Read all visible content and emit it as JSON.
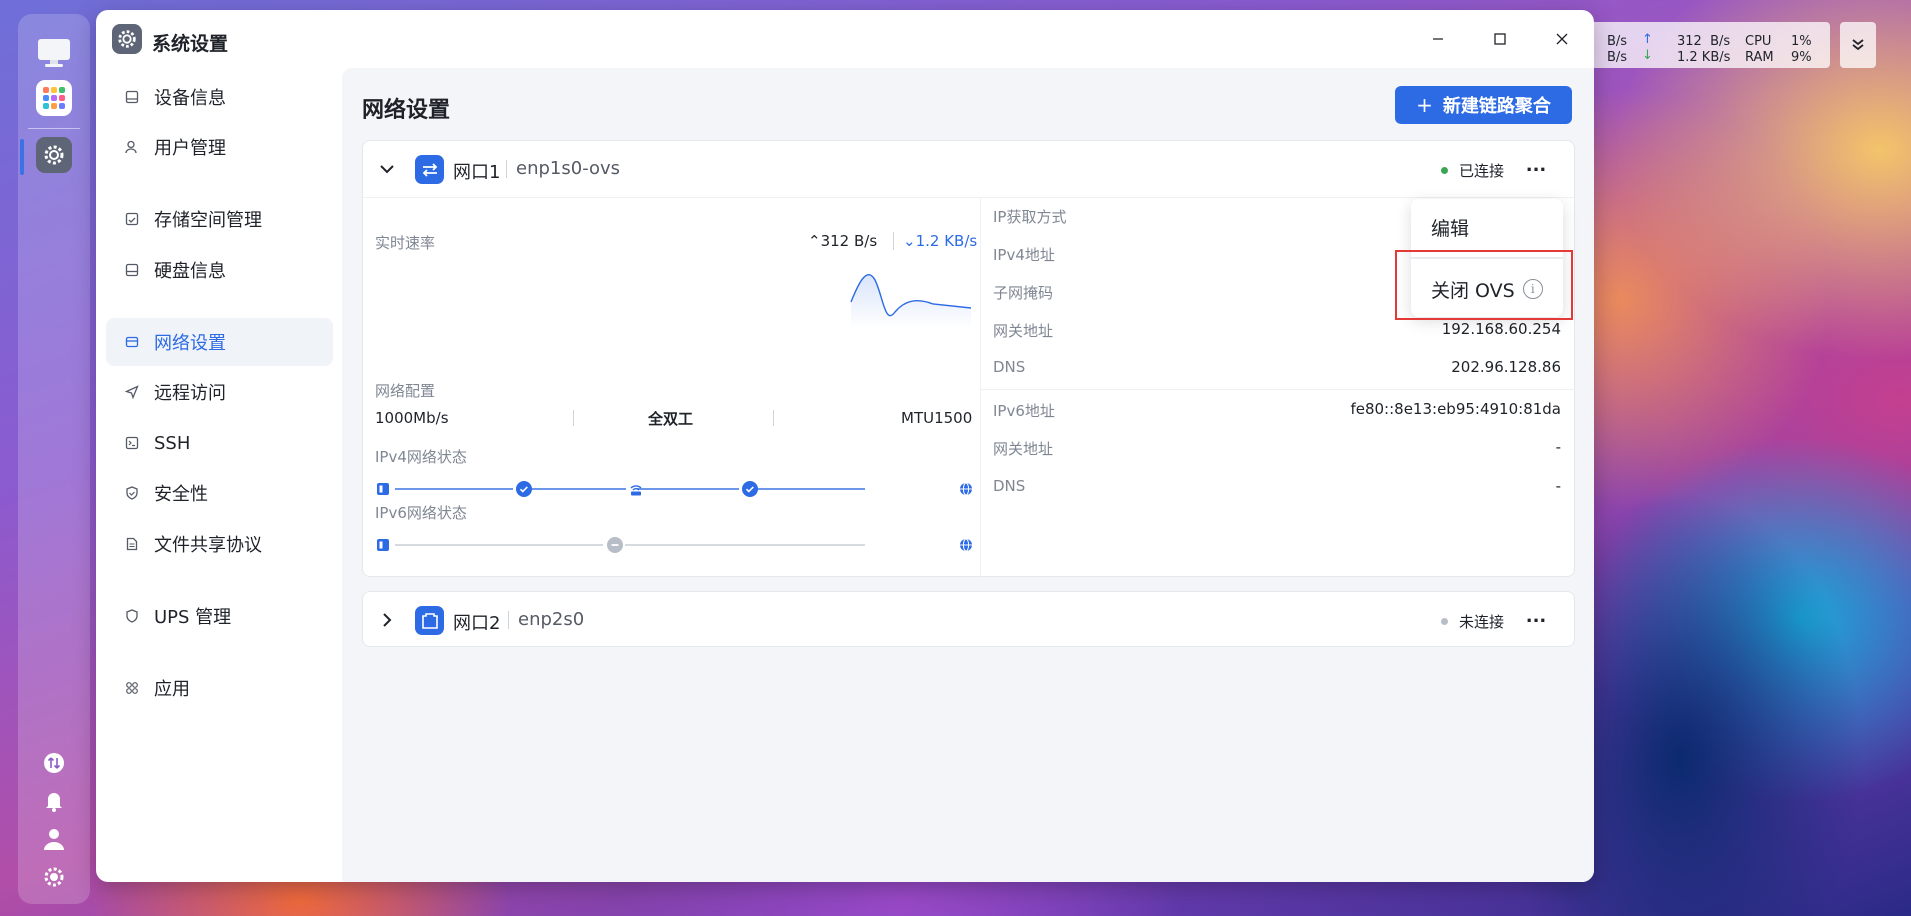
{
  "window": {
    "title": "系统设置",
    "controls": {
      "minimize": "minimize-icon",
      "maximize": "maximize-icon",
      "close": "close-icon"
    }
  },
  "sidebar": {
    "items": [
      {
        "label": "设备信息",
        "icon": "device-icon"
      },
      {
        "label": "用户管理",
        "icon": "user-icon"
      },
      {
        "label": "存储空间管理",
        "icon": "storage-icon"
      },
      {
        "label": "硬盘信息",
        "icon": "disk-icon"
      },
      {
        "label": "网络设置",
        "icon": "network-icon",
        "active": true
      },
      {
        "label": "远程访问",
        "icon": "remote-icon"
      },
      {
        "label": "SSH",
        "icon": "terminal-icon"
      },
      {
        "label": "安全性",
        "icon": "shield-icon"
      },
      {
        "label": "文件共享协议",
        "icon": "file-share-icon"
      },
      {
        "label": "UPS 管理",
        "icon": "ups-icon"
      },
      {
        "label": "应用",
        "icon": "apps-icon"
      }
    ]
  },
  "main": {
    "title": "网络设置",
    "new_button": "新建链路聚合"
  },
  "port1": {
    "name": "网口1",
    "iface": "enp1s0-ovs",
    "status": "已连接",
    "status_color": "#3aa655",
    "more": "...",
    "speed_label": "实时速率",
    "upload": "312 B/s",
    "download": "1.2 KB/s",
    "config_label": "网络配置",
    "link_speed": "1000Mb/s",
    "duplex": "全双工",
    "mtu": "MTU1500",
    "ipv4_status_label": "IPv4网络状态",
    "ipv6_status_label": "IPv6网络状态",
    "ipv4_fields": [
      {
        "key": "IP获取方式",
        "value": ""
      },
      {
        "key": "IPv4地址",
        "value": ""
      },
      {
        "key": "子网掩码",
        "value": ""
      },
      {
        "key": "网关地址",
        "value": "192.168.60.254"
      },
      {
        "key": "DNS",
        "value": "202.96.128.86"
      }
    ],
    "ipv6_fields": [
      {
        "key": "IPv6地址",
        "value": "fe80::8e13:eb95:4910:81da"
      },
      {
        "key": "网关地址",
        "value": "-"
      },
      {
        "key": "DNS",
        "value": "-"
      }
    ]
  },
  "port2": {
    "name": "网口2",
    "iface": "enp2s0",
    "status": "未连接",
    "status_color": "#b8bec8",
    "more": "..."
  },
  "context_menu": {
    "edit": "编辑",
    "close_ovs": "关闭 OVS",
    "info_glyph": "i"
  },
  "sysmon": {
    "net_up_partial": "B/s",
    "net_down_partial": "B/s",
    "up_arrow": "↑",
    "down_arrow": "↓",
    "up_value": "312  B/s",
    "down_value": "1.2 KB/s",
    "cpu_label": "CPU",
    "cpu_value": "1%",
    "ram_label": "RAM",
    "ram_value": "9%"
  }
}
